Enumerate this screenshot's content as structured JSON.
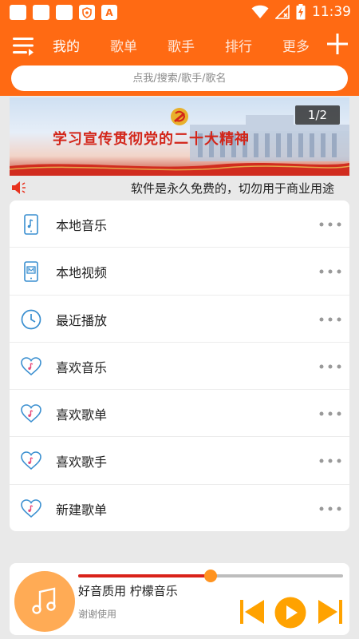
{
  "status_bar": {
    "time": "11:39",
    "notification_a": "A",
    "icons": [
      "app-square-icon",
      "app-square-icon",
      "app-square-icon",
      "shield-icon",
      "a-icon",
      "wifi-icon",
      "signal-icon",
      "battery-charging-icon"
    ]
  },
  "nav": {
    "tabs": [
      {
        "label": "我的",
        "active": true
      },
      {
        "label": "歌单"
      },
      {
        "label": "歌手"
      },
      {
        "label": "排行"
      },
      {
        "label": "更多"
      }
    ]
  },
  "search": {
    "placeholder": "点我/搜索/歌手/歌名"
  },
  "banner": {
    "title": "学习宣传贯彻党的二十大精神",
    "counter": "1/2"
  },
  "marquee": {
    "text": "软件是永久免费的，切勿用于商业用途"
  },
  "menu": {
    "items": [
      {
        "label": "本地音乐",
        "icon": "phone-music-icon"
      },
      {
        "label": "本地视频",
        "icon": "video-file-icon"
      },
      {
        "label": "最近播放",
        "icon": "clock-icon"
      },
      {
        "label": "喜欢音乐",
        "icon": "heart-music-icon"
      },
      {
        "label": "喜欢歌单",
        "icon": "heart-music-icon"
      },
      {
        "label": "喜欢歌手",
        "icon": "heart-music-icon"
      },
      {
        "label": "新建歌单",
        "icon": "heart-music-icon"
      }
    ]
  },
  "player": {
    "title": "好音质用 柠檬音乐",
    "artist": "谢谢使用",
    "progress": 0.5
  },
  "colors": {
    "accent": "#ff6a13",
    "progress_fill": "#d9221a",
    "thumb": "#ff9320",
    "disc": "#ffab55",
    "control": "#ffa200",
    "icon_blue": "#3a8fd0"
  }
}
